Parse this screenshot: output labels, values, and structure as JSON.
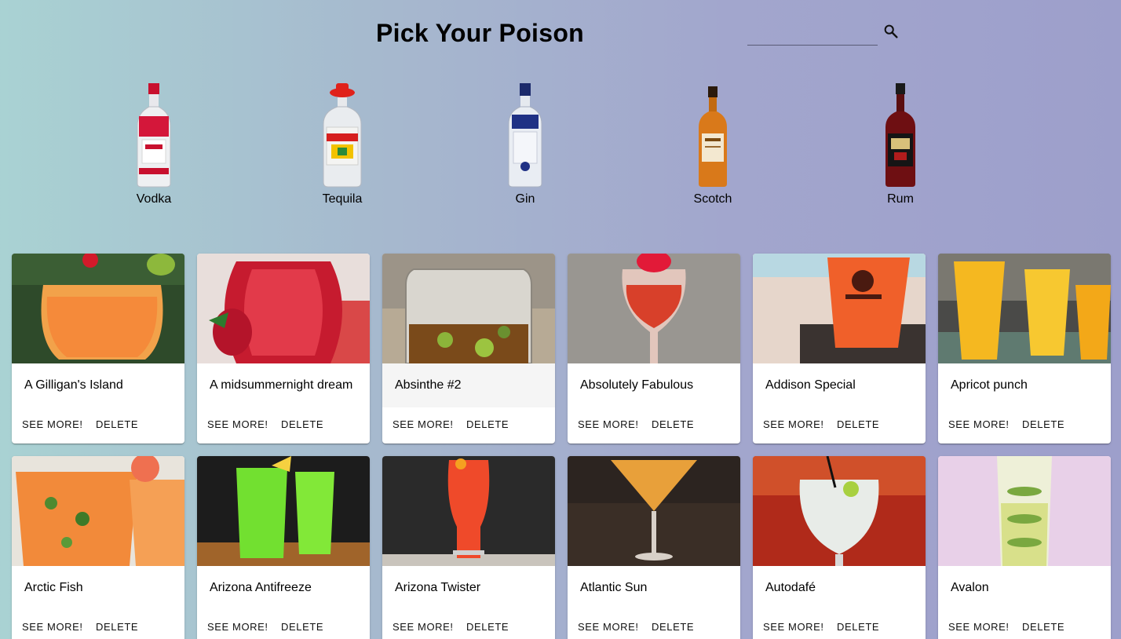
{
  "header": {
    "title": "Pick Your Poison",
    "search_placeholder": "",
    "search_value": ""
  },
  "spirits": [
    {
      "label": "Vodka",
      "icon": "vodka-bottle-icon"
    },
    {
      "label": "Tequila",
      "icon": "tequila-bottle-icon"
    },
    {
      "label": "Gin",
      "icon": "gin-bottle-icon"
    },
    {
      "label": "Scotch",
      "icon": "scotch-bottle-icon"
    },
    {
      "label": "Rum",
      "icon": "rum-bottle-icon"
    }
  ],
  "cards": [
    {
      "title": "A Gilligan's Island",
      "see_more": "See more!",
      "delete": "Delete"
    },
    {
      "title": "A midsummernight dream",
      "see_more": "See more!",
      "delete": "Delete"
    },
    {
      "title": "Absinthe #2",
      "see_more": "See more!",
      "delete": "Delete"
    },
    {
      "title": "Absolutely Fabulous",
      "see_more": "See more!",
      "delete": "Delete"
    },
    {
      "title": "Addison Special",
      "see_more": "See more!",
      "delete": "Delete"
    },
    {
      "title": "Apricot punch",
      "see_more": "See more!",
      "delete": "Delete"
    },
    {
      "title": "Arctic Fish",
      "see_more": "See more!",
      "delete": "Delete"
    },
    {
      "title": "Arizona Antifreeze",
      "see_more": "See more!",
      "delete": "Delete"
    },
    {
      "title": "Arizona Twister",
      "see_more": "See more!",
      "delete": "Delete"
    },
    {
      "title": "Atlantic Sun",
      "see_more": "See more!",
      "delete": "Delete"
    },
    {
      "title": "Autodafé",
      "see_more": "See more!",
      "delete": "Delete"
    },
    {
      "title": "Avalon",
      "see_more": "See more!",
      "delete": "Delete"
    }
  ],
  "colors": {
    "background_start": "#a9d2d3",
    "background_end": "#9d9fcb",
    "card_bg": "#ffffff",
    "hover_bg": "#f5f5f5"
  }
}
